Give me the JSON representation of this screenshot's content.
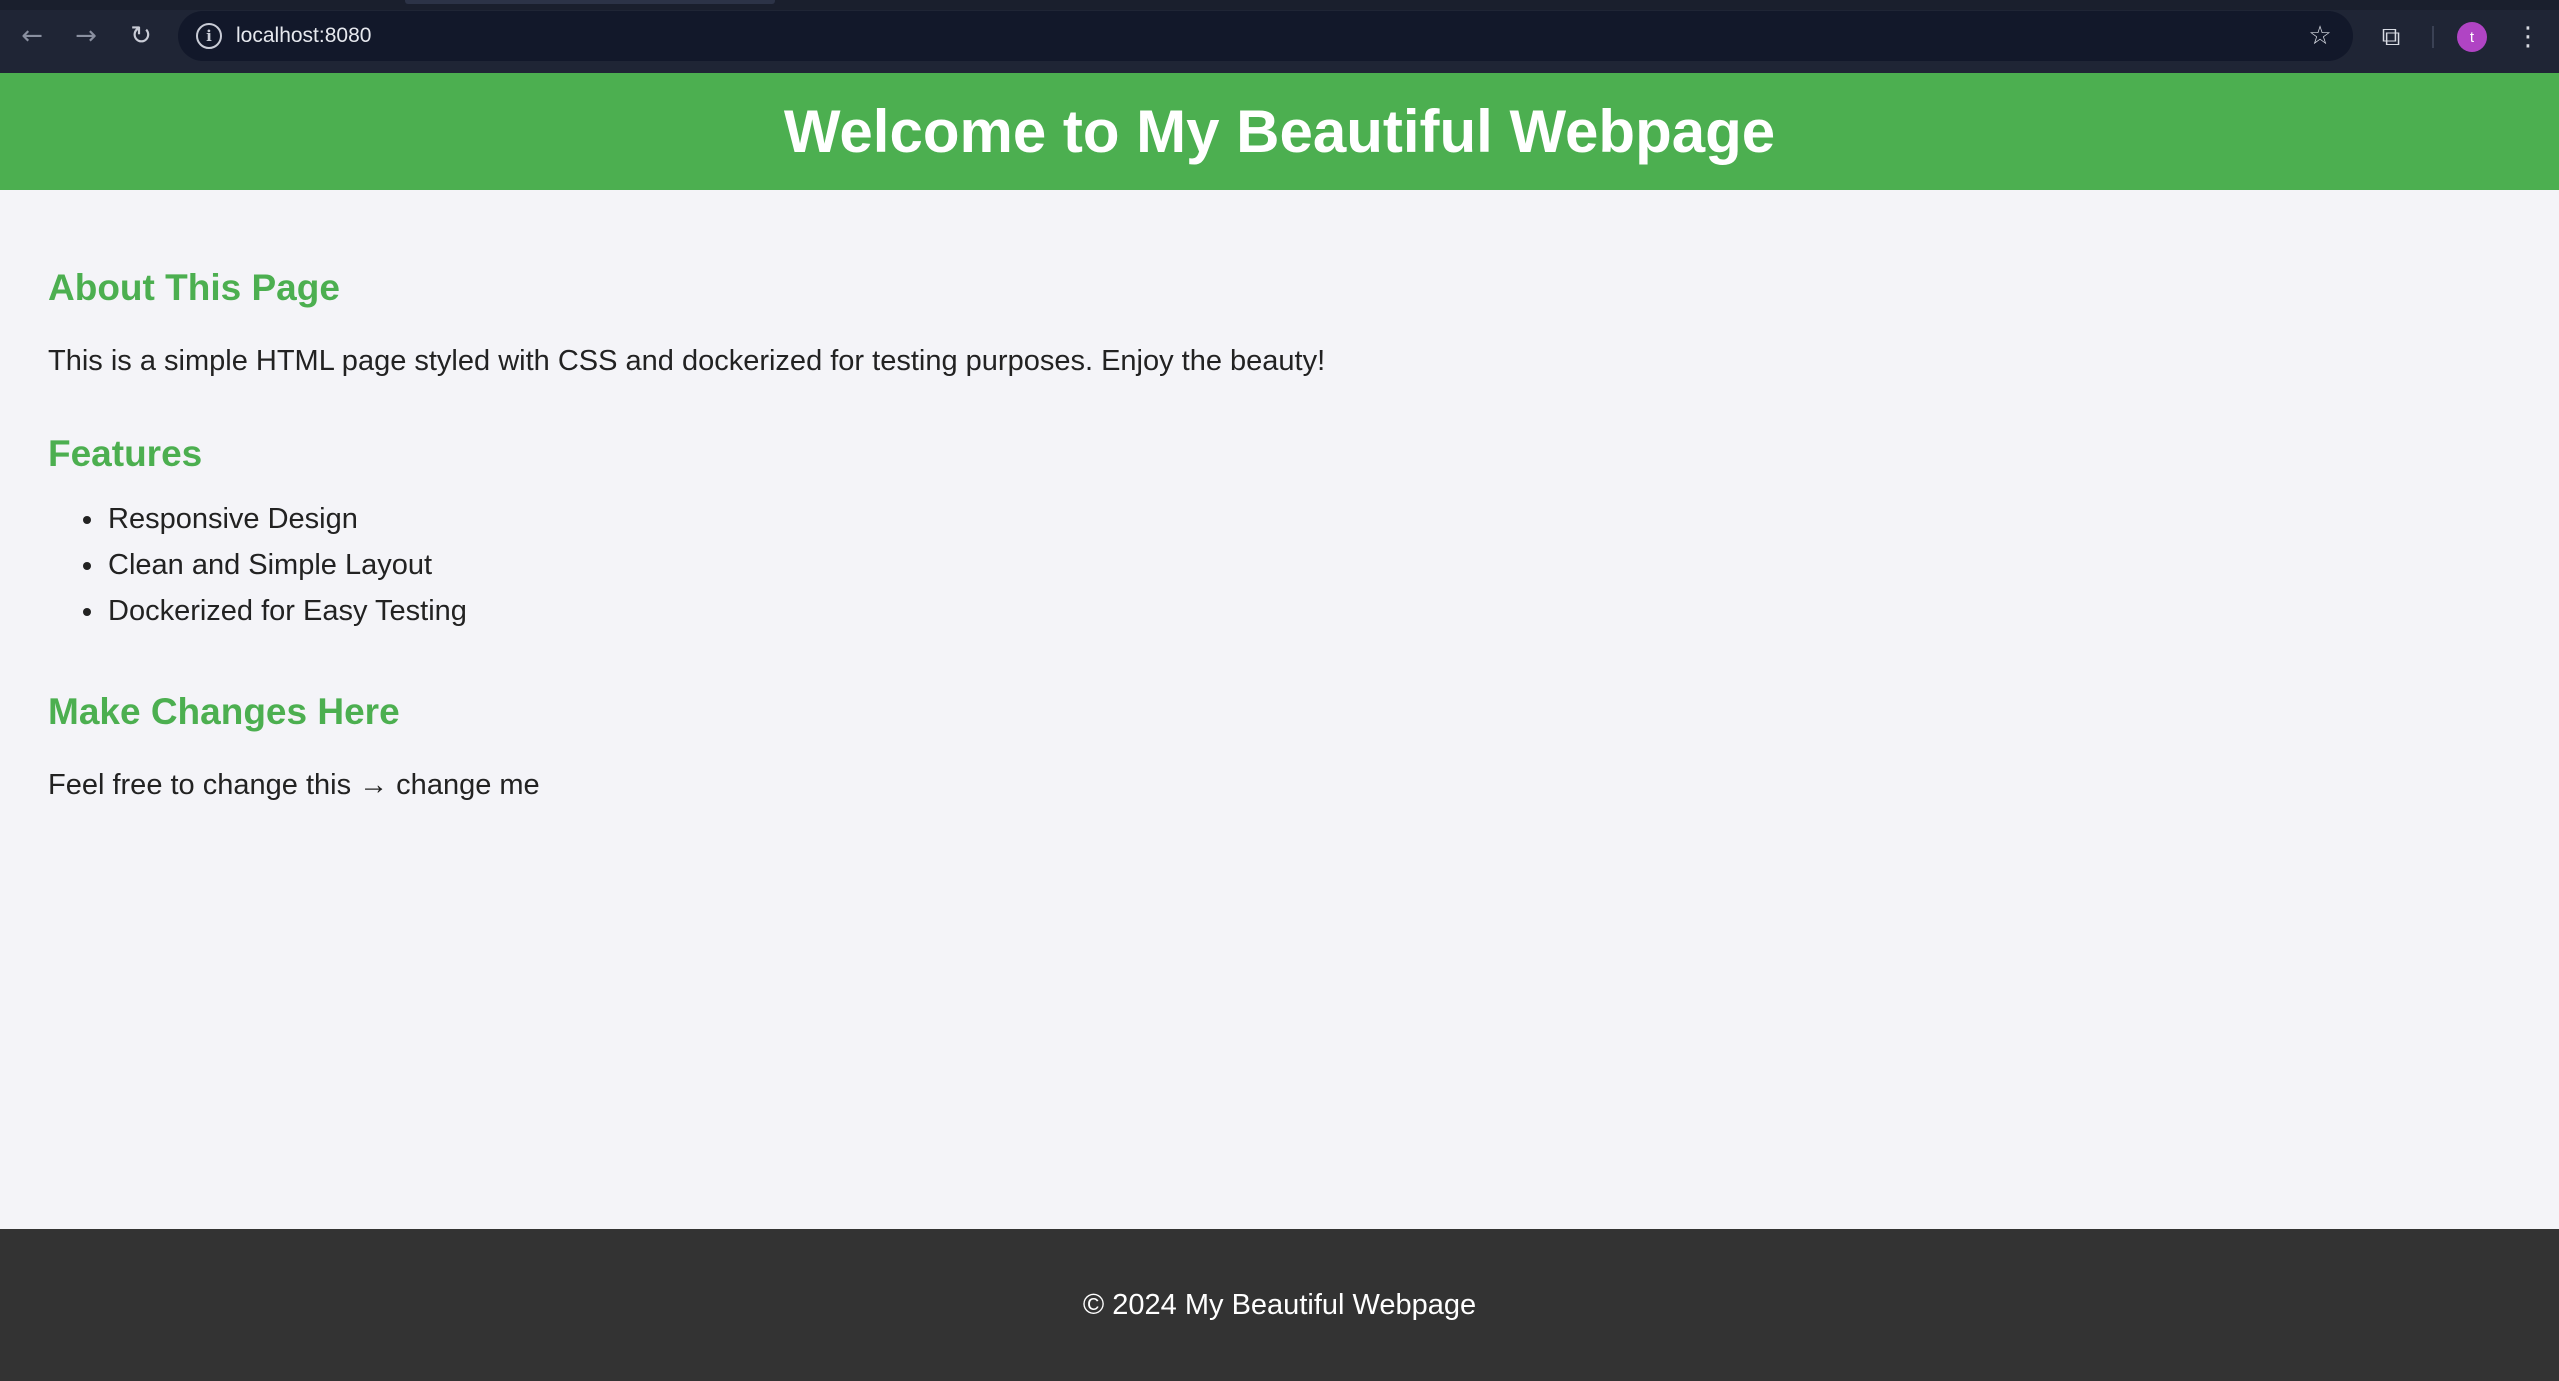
{
  "browser": {
    "url": "localhost:8080",
    "back_icon": "arrow-left-icon",
    "forward_icon": "arrow-right-icon",
    "reload_icon": "reload-icon",
    "info_icon": "info-icon",
    "bookmark_icon": "star-icon",
    "extensions_icon": "puzzle-icon",
    "profile_initial": "t",
    "profile_color": "#b044c4",
    "menu_icon": "kebab-menu-icon"
  },
  "header": {
    "title": "Welcome to My Beautiful Webpage",
    "background": "#4caf50"
  },
  "sections": {
    "about": {
      "title": "About This Page",
      "text": "This is a simple HTML page styled with CSS and dockerized for testing purposes. Enjoy the beauty!"
    },
    "features": {
      "title": "Features",
      "items": [
        "Responsive Design",
        "Clean and Simple Layout",
        "Dockerized for Easy Testing"
      ]
    },
    "changes": {
      "title": "Make Changes Here",
      "text": "Feel free to change this → change me"
    }
  },
  "footer": {
    "text": "© 2024 My Beautiful Webpage",
    "background": "#333333"
  },
  "colors": {
    "accent": "#4caf50",
    "page_background": "#f4f4f8",
    "chrome_background": "#1f2535"
  }
}
